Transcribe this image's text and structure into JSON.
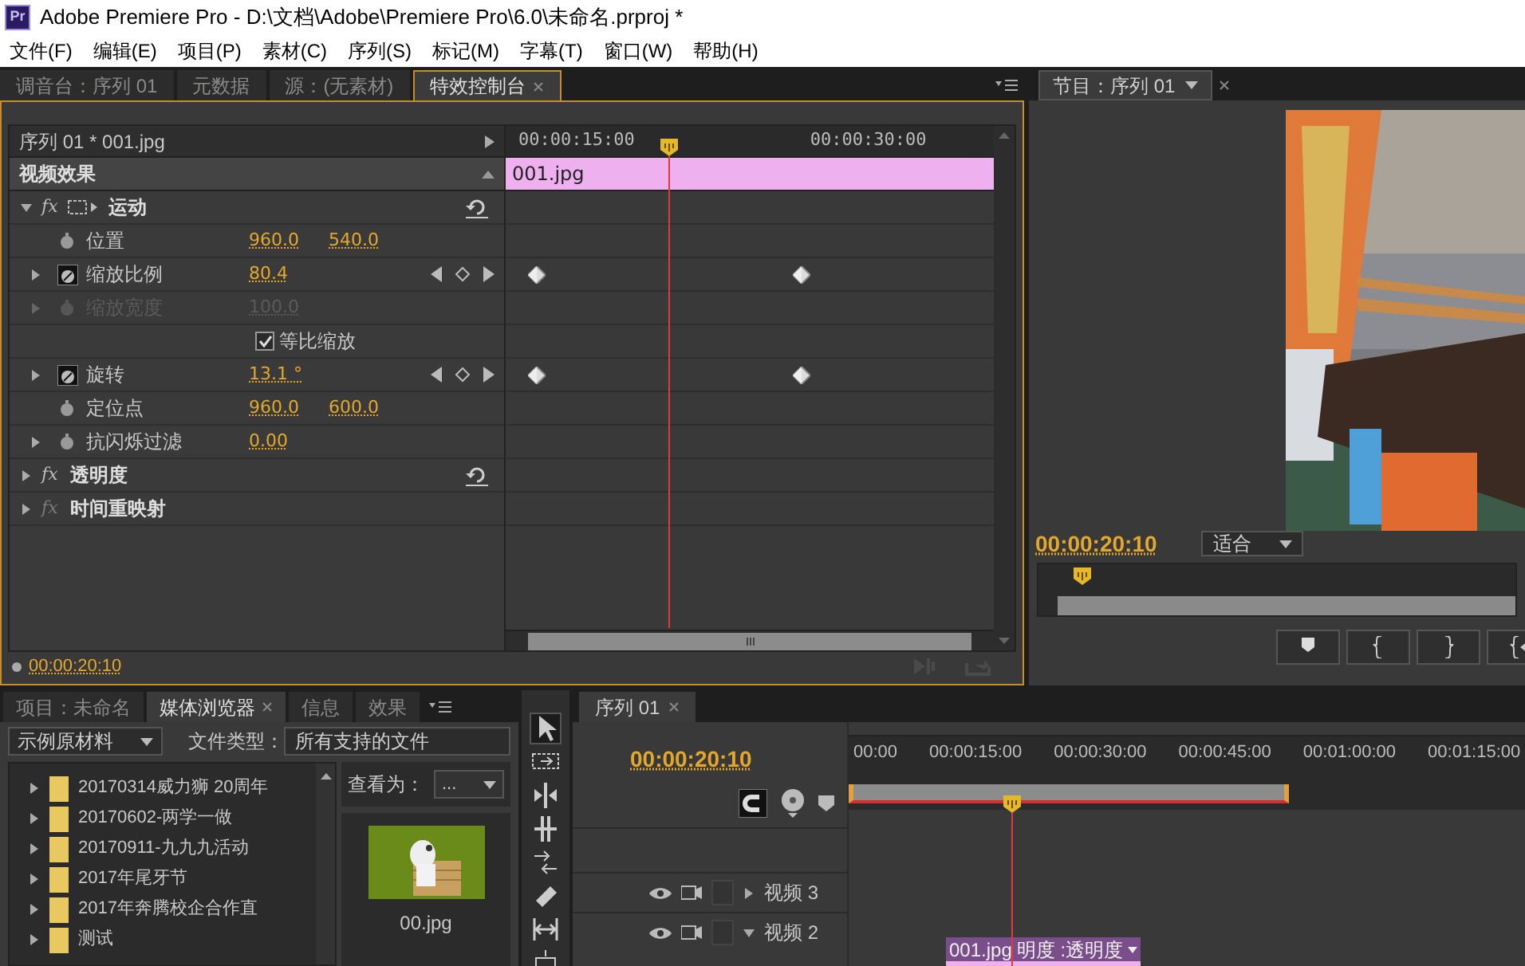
{
  "window": {
    "app_badge": "Pr",
    "title": "Adobe Premiere Pro - D:\\文档\\Adobe\\Premiere Pro\\6.0\\未命名.prproj *"
  },
  "menu": [
    "文件(F)",
    "编辑(E)",
    "项目(P)",
    "素材(C)",
    "序列(S)",
    "标记(M)",
    "字幕(T)",
    "窗口(W)",
    "帮助(H)"
  ],
  "effect_panel": {
    "tabs": [
      {
        "label": "调音台：序列 01",
        "selected": false
      },
      {
        "label": "元数据",
        "selected": false
      },
      {
        "label": "源：(无素材)",
        "selected": false
      },
      {
        "label": "特效控制台",
        "selected": true
      }
    ],
    "clip_header": "序列 01 * 001.jpg",
    "section": "视频效果",
    "ruler": [
      "00:00:15:00",
      "00:00:30:00"
    ],
    "clip_bar": "001.jpg",
    "rows": [
      {
        "kind": "effect",
        "name": "运动",
        "fx": "fx",
        "fx_enabled": true,
        "expanded": true,
        "resettable": true,
        "motion_icon": true
      },
      {
        "kind": "param",
        "name": "位置",
        "values": [
          "960.0",
          "540.0"
        ],
        "expandable": false,
        "animated": false,
        "disabled": false
      },
      {
        "kind": "param",
        "name": "缩放比例",
        "values": [
          "80.4"
        ],
        "expandable": true,
        "animated": true,
        "disabled": false
      },
      {
        "kind": "param",
        "name": "缩放宽度",
        "values": [
          "100.0"
        ],
        "expandable": true,
        "animated": false,
        "disabled": true
      },
      {
        "kind": "checkbox",
        "name": "等比缩放",
        "checked": true
      },
      {
        "kind": "param",
        "name": "旋转",
        "values": [
          "13.1 °"
        ],
        "expandable": true,
        "animated": true,
        "disabled": false
      },
      {
        "kind": "param",
        "name": "定位点",
        "values": [
          "960.0",
          "600.0"
        ],
        "expandable": false,
        "animated": false,
        "disabled": false
      },
      {
        "kind": "param",
        "name": "抗闪烁过滤",
        "values": [
          "0.00"
        ],
        "expandable": true,
        "animated": false,
        "disabled": false
      },
      {
        "kind": "effect",
        "name": "透明度",
        "fx": "fx",
        "fx_enabled": true,
        "expanded": false,
        "resettable": true,
        "motion_icon": false
      },
      {
        "kind": "effect",
        "name": "时间重映射",
        "fx": "fx",
        "fx_enabled": false,
        "expanded": false,
        "resettable": false,
        "motion_icon": false
      }
    ],
    "timecode": "00:00:20:10"
  },
  "program_monitor": {
    "tab": "节目：序列 01",
    "timecode": "00:00:20:10",
    "zoom": "适合"
  },
  "project_panel": {
    "tabs": [
      {
        "label": "项目：未命名",
        "selected": false
      },
      {
        "label": "媒体浏览器",
        "selected": true
      },
      {
        "label": "信息",
        "selected": false
      },
      {
        "label": "效果",
        "selected": false
      }
    ],
    "source": "示例原材料",
    "file_type_label": "文件类型：",
    "file_type": "所有支持的文件",
    "folders": [
      "20170314威力狮 20周年",
      "20170602-两学一做",
      "20170911-九九九活动",
      "2017年尾牙节",
      "2017年奔腾校企合作直",
      "测试"
    ],
    "view_as_label": "查看为：",
    "view_as": "...",
    "thumbnail": {
      "kind": "picture",
      "label": "00.jpg"
    }
  },
  "timeline": {
    "tab": "序列 01",
    "timecode": "00:00:20:10",
    "ruler": [
      "00:00",
      "00:00:15:00",
      "00:00:30:00",
      "00:00:45:00",
      "00:01:00:00",
      "00:01:15:00"
    ],
    "tracks": [
      {
        "name": "视频 3",
        "expanded": false
      },
      {
        "name": "视频 2",
        "expanded": true
      }
    ],
    "clip": {
      "name": "001.jpg",
      "effect": "明度 :透明度"
    }
  }
}
